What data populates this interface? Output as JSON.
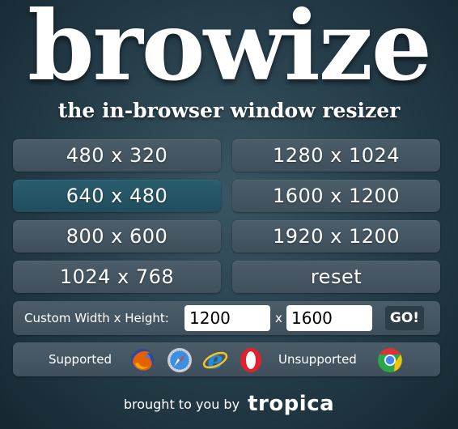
{
  "header": {
    "title": "browize",
    "subtitle": "the in-browser window resizer"
  },
  "resolutions": {
    "r1": "480 x 320",
    "r2": "1280 x 1024",
    "r3": "640 x 480",
    "r4": "1600 x 1200",
    "r5": "800 x 600",
    "r6": "1920 x 1200",
    "r7": "1024 x 768",
    "reset": "reset",
    "active": "640 x 480"
  },
  "custom": {
    "label": "Custom Width x Height:",
    "width_value": "1200",
    "separator": "x",
    "height_value": "1600",
    "go_label": "GO!"
  },
  "browsers": {
    "supported_label": "Supported",
    "unsupported_label": "Unsupported",
    "supported_icons": [
      "firefox-icon",
      "safari-icon",
      "internet-explorer-icon",
      "opera-icon"
    ],
    "unsupported_icons": [
      "chrome-icon"
    ]
  },
  "footer": {
    "text": "brought to you by",
    "brand": "tropica"
  },
  "colors": {
    "background": "#243c48",
    "button": "#45566 2",
    "active_button": "#2a5d6e",
    "go_button": "#2c3e48"
  }
}
